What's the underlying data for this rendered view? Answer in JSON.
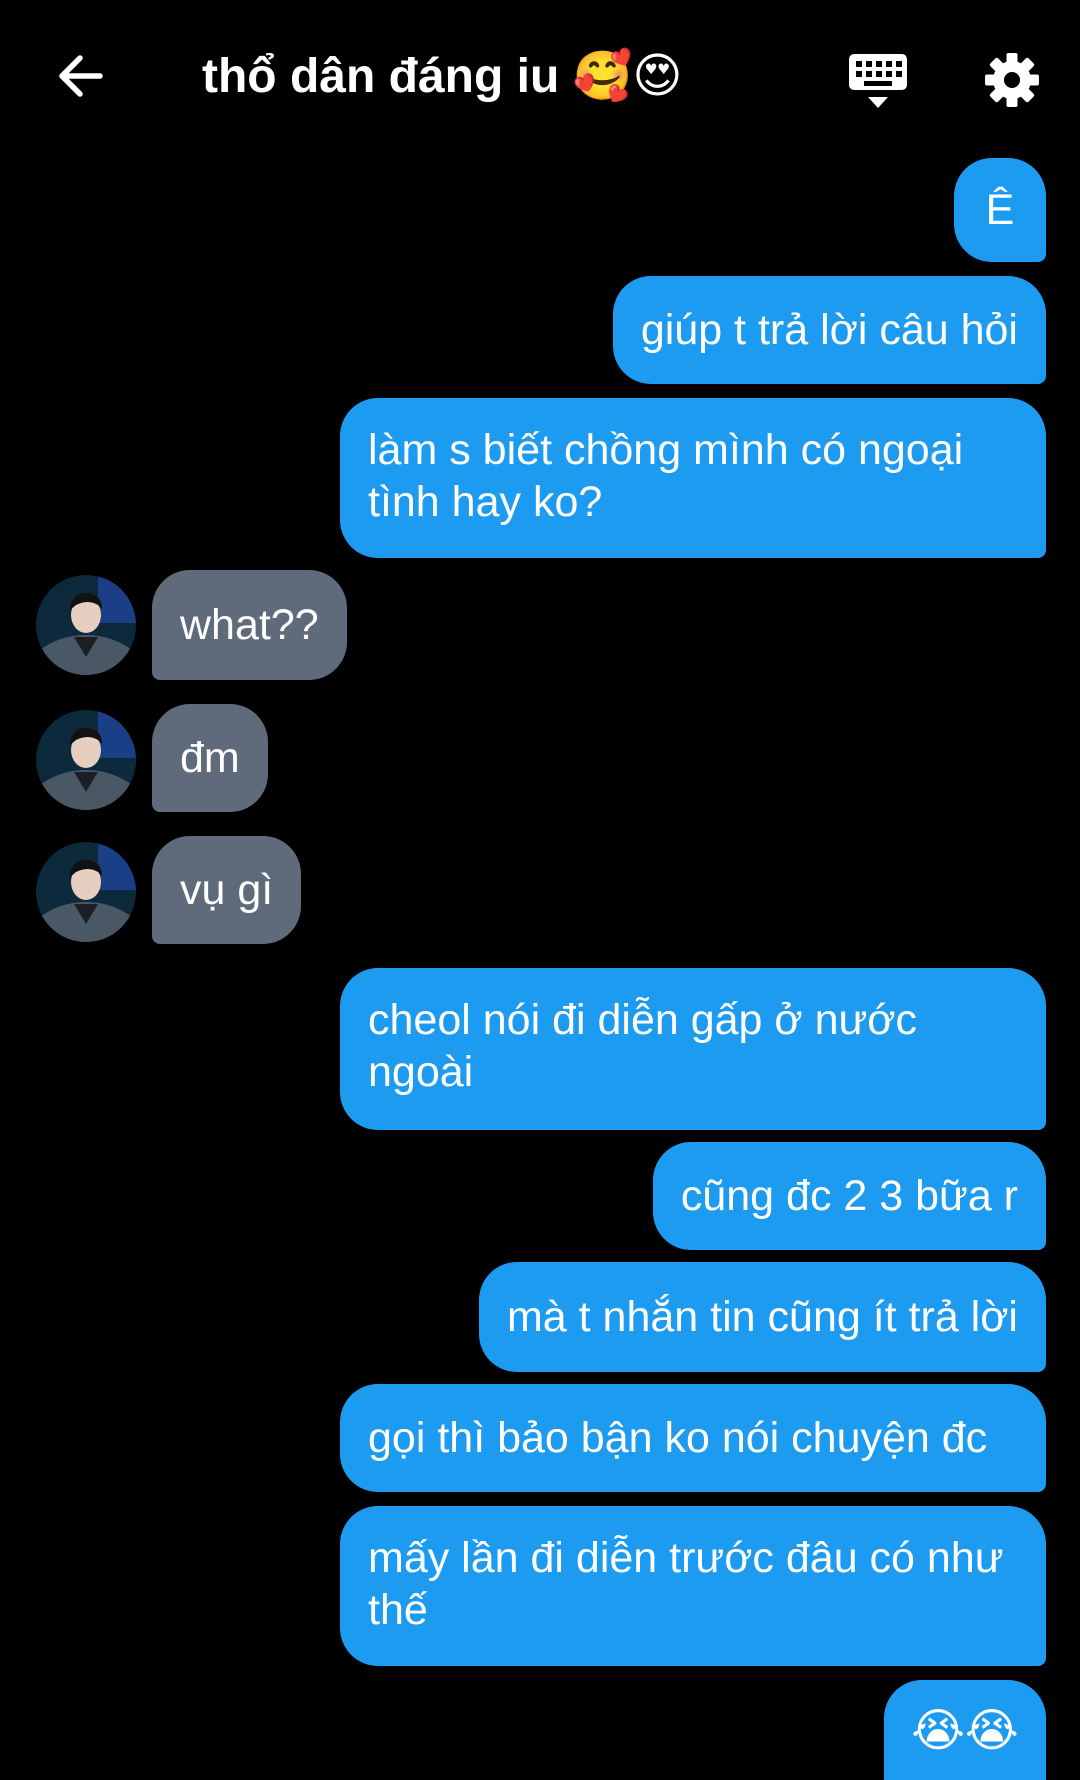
{
  "header": {
    "title": "thổ dân đáng iu 🥰😍",
    "back_icon": "arrow-left-icon",
    "keyboard_icon": "keyboard-icon",
    "settings_icon": "gear-icon"
  },
  "colors": {
    "outgoing_bubble": "#1d9bf0",
    "incoming_bubble": "#5f6b7b",
    "background": "#000000"
  },
  "messages": [
    {
      "side": "out",
      "text": "Ê"
    },
    {
      "side": "out",
      "text": "giúp t trả lời câu hỏi"
    },
    {
      "side": "out",
      "text": "làm s biết chồng mình có ngoại tình hay ko?"
    },
    {
      "side": "in",
      "text": "what??"
    },
    {
      "side": "in",
      "text": "đm"
    },
    {
      "side": "in",
      "text": "vụ gì"
    },
    {
      "side": "out",
      "text": "cheol nói đi diễn gấp ở nước ngoài"
    },
    {
      "side": "out",
      "text": "cũng đc 2 3 bữa r"
    },
    {
      "side": "out",
      "text": "mà t nhắn tin cũng ít trả lời"
    },
    {
      "side": "out",
      "text": "gọi thì bảo bận ko nói chuyện đc"
    },
    {
      "side": "out",
      "text": "mấy lần đi diễn trước đâu có như thế"
    },
    {
      "side": "out",
      "text": "😭😭"
    }
  ]
}
